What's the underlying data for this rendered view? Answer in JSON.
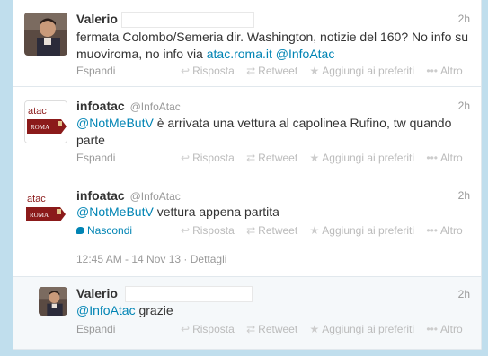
{
  "tweets": [
    {
      "name": "Valerio",
      "handle": "",
      "time": "2h",
      "text_plain": "fermata Colombo/Semeria dir. Washington, notizie del 160? No info su muoviroma, no info via ",
      "link1": "atac.roma.it",
      "link2": "@InfoAtac",
      "expand": "Espandi"
    },
    {
      "name": "infoatac",
      "handle": "@InfoAtac",
      "time": "2h",
      "mention": "@NotMeButV",
      "text": " è arrivata una vettura al capolinea Rufino, tw quando parte",
      "expand": "Espandi"
    },
    {
      "name": "infoatac",
      "handle": "@InfoAtac",
      "time": "2h",
      "mention": "@NotMeButV",
      "text": " vettura appena partita",
      "hide": "Nascondi",
      "timestamp": "12:45 AM - 14 Nov 13",
      "details": "Dettagli"
    },
    {
      "name": "Valerio",
      "time": "2h",
      "mention": "@InfoAtac",
      "text": " grazie",
      "expand": "Espandi"
    }
  ],
  "actions": {
    "reply": "Risposta",
    "retweet": "Retweet",
    "favorite": "Aggiungi ai preferiti",
    "more": "Altro"
  },
  "brand": {
    "logo_text": "atac",
    "logo_sub": "ROMA",
    "accent": "#0084b4",
    "brand_red": "#8b1a1a"
  }
}
